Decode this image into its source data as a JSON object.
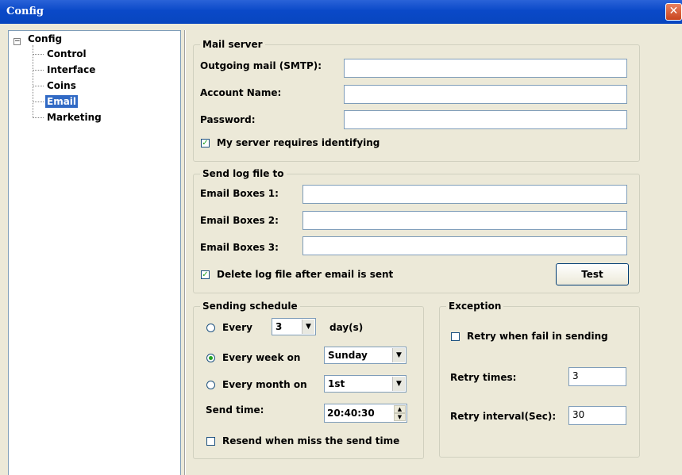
{
  "window": {
    "title": "Config",
    "close_glyph": "✕"
  },
  "tree": {
    "root_label": "Config",
    "expander": "−",
    "items": [
      "Control",
      "Interface",
      "Coins",
      "Email",
      "Marketing"
    ],
    "selected": "Email"
  },
  "mail_server": {
    "legend": "Mail server",
    "smtp_label": "Outgoing mail (SMTP):",
    "smtp_value": "",
    "account_label": "Account Name:",
    "account_value": "",
    "password_label": "Password:",
    "password_value": "",
    "identify_label": "My server requires identifying",
    "identify_checked": true
  },
  "send_log": {
    "legend": "Send log file to",
    "box1_label": "Email Boxes 1:",
    "box1_value": "",
    "box2_label": "Email Boxes 2:",
    "box2_value": "",
    "box3_label": "Email Boxes 3:",
    "box3_value": "",
    "delete_label": "Delete log file after email is sent",
    "delete_checked": true,
    "test_label": "Test"
  },
  "schedule": {
    "legend": "Sending schedule",
    "every_label": "Every",
    "every_value": "3",
    "days_unit": "day(s)",
    "week_label": "Every week on",
    "week_value": "Sunday",
    "month_label": "Every month on",
    "month_value": "1st",
    "selected_option": "week",
    "send_time_label": "Send time:",
    "send_time_value": "20:40:30",
    "resend_label": "Resend when miss the send time",
    "resend_checked": false
  },
  "exception": {
    "legend": "Exception",
    "retry_label": "Retry when fail in sending",
    "retry_checked": false,
    "times_label": "Retry times:",
    "times_value": "3",
    "interval_label": "Retry interval(Sec):",
    "interval_value": "30"
  },
  "icons": {
    "check_mark": "✓",
    "dropdown_arrow": "▼",
    "spin_up": "▲",
    "spin_down": "▼"
  },
  "colors": {
    "titlebar": "#0a49c8",
    "dialog_bg": "#ece9d8",
    "selection": "#316ac5",
    "check": "#21a121"
  }
}
